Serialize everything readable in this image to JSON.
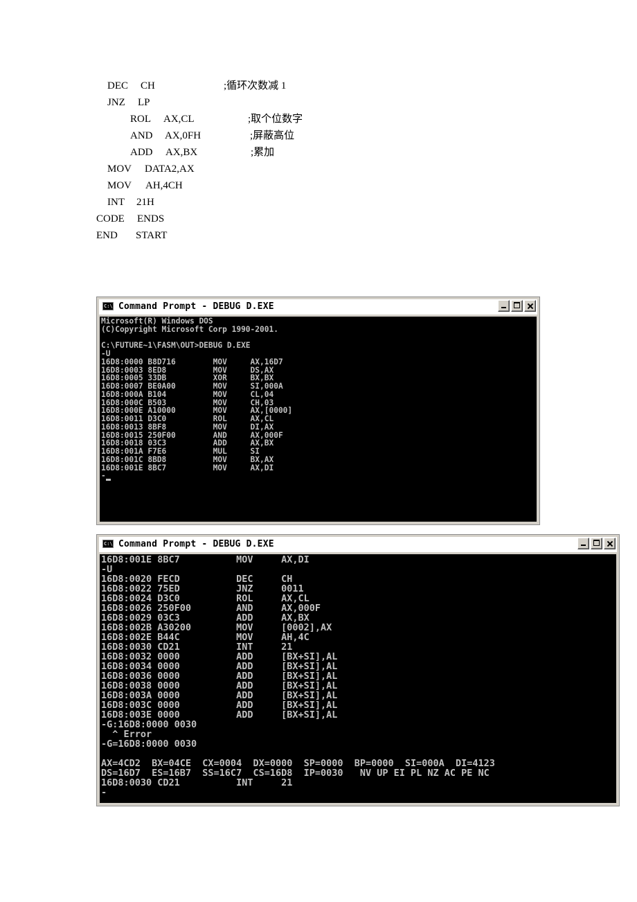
{
  "document": {
    "lines": [
      {
        "tokens": [
          "DEC",
          "CH",
          ";循环次数减 1"
        ]
      },
      {
        "tokens": [
          "JNZ",
          "LP"
        ]
      },
      {
        "tokens": [
          "ROL",
          "AX,CL",
          ";取个位数字"
        ]
      },
      {
        "tokens": [
          "AND",
          "AX,0FH",
          ";屏蔽高位"
        ]
      },
      {
        "tokens": [
          "ADD",
          "AX,BX",
          ";累加"
        ]
      },
      {
        "tokens": [
          "MOV",
          "DATA2,AX"
        ]
      },
      {
        "tokens": [
          "MOV",
          "AH,4CH"
        ]
      },
      {
        "tokens": [
          "INT",
          "21H"
        ]
      },
      {
        "tokens": [
          "CODE",
          "ENDS"
        ]
      },
      {
        "tokens": [
          "END",
          "START"
        ]
      }
    ]
  },
  "window1": {
    "icon_text": "C:\\",
    "title": "Command Prompt - DEBUG D.EXE",
    "lines": [
      "Microsoft(R) Windows DOS",
      "(C)Copyright Microsoft Corp 1990-2001.",
      "",
      "C:\\FUTURE~1\\FASM\\OUT>DEBUG D.EXE",
      "-U",
      "16D8:0000 B8D716        MOV     AX,16D7",
      "16D8:0003 8ED8          MOV     DS,AX",
      "16D8:0005 33DB          XOR     BX,BX",
      "16D8:0007 BE0A00        MOV     SI,000A",
      "16D8:000A B104          MOV     CL,04",
      "16D8:000C B503          MOV     CH,03",
      "16D8:000E A10000        MOV     AX,[0000]",
      "16D8:0011 D3C0          ROL     AX,CL",
      "16D8:0013 8BF8          MOV     DI,AX",
      "16D8:0015 250F00        AND     AX,000F",
      "16D8:0018 03C3          ADD     AX,BX",
      "16D8:001A F7E6          MUL     SI",
      "16D8:001C 8BD8          MOV     BX,AX",
      "16D8:001E 8BC7          MOV     AX,DI",
      "-"
    ]
  },
  "window2": {
    "icon_text": "C:\\",
    "title": "Command Prompt - DEBUG D.EXE",
    "lines": [
      "16D8:001E 8BC7          MOV     AX,DI",
      "-U",
      "16D8:0020 FECD          DEC     CH",
      "16D8:0022 75ED          JNZ     0011",
      "16D8:0024 D3C0          ROL     AX,CL",
      "16D8:0026 250F00        AND     AX,000F",
      "16D8:0029 03C3          ADD     AX,BX",
      "16D8:002B A30200        MOV     [0002],AX",
      "16D8:002E B44C          MOV     AH,4C",
      "16D8:0030 CD21          INT     21",
      "16D8:0032 0000          ADD     [BX+SI],AL",
      "16D8:0034 0000          ADD     [BX+SI],AL",
      "16D8:0036 0000          ADD     [BX+SI],AL",
      "16D8:0038 0000          ADD     [BX+SI],AL",
      "16D8:003A 0000          ADD     [BX+SI],AL",
      "16D8:003C 0000          ADD     [BX+SI],AL",
      "16D8:003E 0000          ADD     [BX+SI],AL",
      "-G:16D8:0000 0030",
      "  ^ Error",
      "-G=16D8:0000 0030",
      "",
      "AX=4CD2  BX=04CE  CX=0004  DX=0000  SP=0000  BP=0000  SI=000A  DI=4123",
      "DS=16D7  ES=16B7  SS=16C7  CS=16D8  IP=0030   NV UP EI PL NZ AC PE NC",
      "16D8:0030 CD21          INT     21",
      "-"
    ]
  }
}
